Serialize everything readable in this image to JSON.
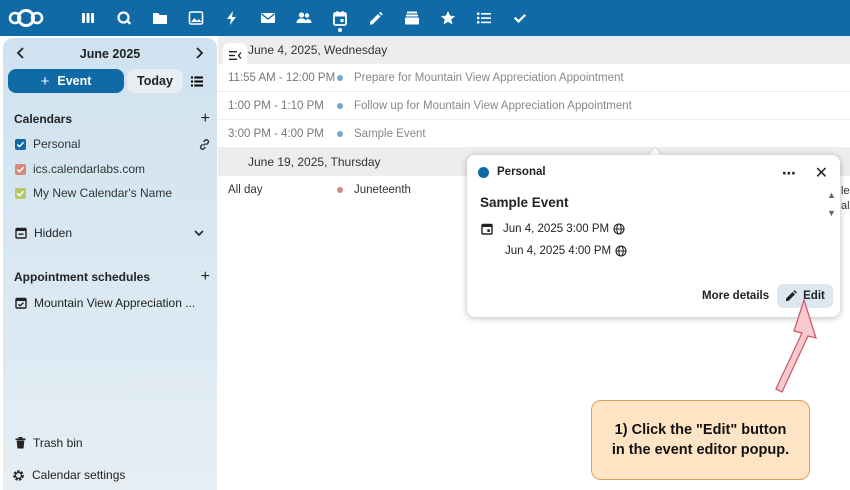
{
  "topbar": {
    "logo": "nextcloud-logo",
    "apps": [
      {
        "name": "dashboard-icon"
      },
      {
        "name": "search-icon"
      },
      {
        "name": "files-icon"
      },
      {
        "name": "photos-icon"
      },
      {
        "name": "activity-icon"
      },
      {
        "name": "mail-icon"
      },
      {
        "name": "contacts-icon"
      },
      {
        "name": "calendar-icon",
        "active": true
      },
      {
        "name": "notes-icon"
      },
      {
        "name": "deck-icon"
      },
      {
        "name": "favorites-icon"
      },
      {
        "name": "list-icon"
      },
      {
        "name": "tasks-icon"
      }
    ],
    "color": "#0f6aa6"
  },
  "sidebar": {
    "month": "June 2025",
    "new_event_label": "Event",
    "today_label": "Today",
    "calendars_heading": "Calendars",
    "calendars": [
      {
        "label": "Personal",
        "color": "#0f6aa6",
        "checked": true
      },
      {
        "label": "ics.calendarlabs.com",
        "color": "#d58a7f",
        "checked": true
      },
      {
        "label": "My New Calendar's Name",
        "color": "#b7c96a",
        "checked": true
      }
    ],
    "hidden_label": "Hidden",
    "appointments_heading": "Appointment schedules",
    "appointments": [
      {
        "label": "Mountain View Appreciation ..."
      }
    ],
    "trash_label": "Trash bin",
    "settings_label": "Calendar settings"
  },
  "main": {
    "days": [
      {
        "heading": "June 4, 2025, Wednesday",
        "events": [
          {
            "time": "11:55 AM - 12:00 PM",
            "title": "Prepare for Mountain View Appreciation Appointment",
            "color": "#6fa8d0"
          },
          {
            "time": "1:00 PM - 1:10 PM",
            "title": "Follow up for Mountain View Appreciation Appointment",
            "color": "#6fa8d0"
          },
          {
            "time": "3:00 PM - 4:00 PM",
            "title": "Sample Event",
            "color": "#6fa8d0"
          }
        ]
      },
      {
        "heading": "June 19, 2025, Thursday",
        "events": [
          {
            "time": "All day",
            "title": "Juneteenth",
            "color": "#d58a7f"
          }
        ]
      }
    ],
    "clipped_right_text": [
      "le",
      "al"
    ]
  },
  "popup": {
    "calendar_name": "Personal",
    "more_icon": "⋯",
    "close_icon": "✕",
    "title": "Sample Event",
    "start": "Jun 4, 2025 3:00 PM",
    "end": "Jun 4, 2025 4:00 PM",
    "more_details_label": "More details",
    "edit_label": "Edit"
  },
  "annotation": {
    "line1": "1) Click the \"Edit\" button",
    "line2": "in the event editor popup."
  }
}
